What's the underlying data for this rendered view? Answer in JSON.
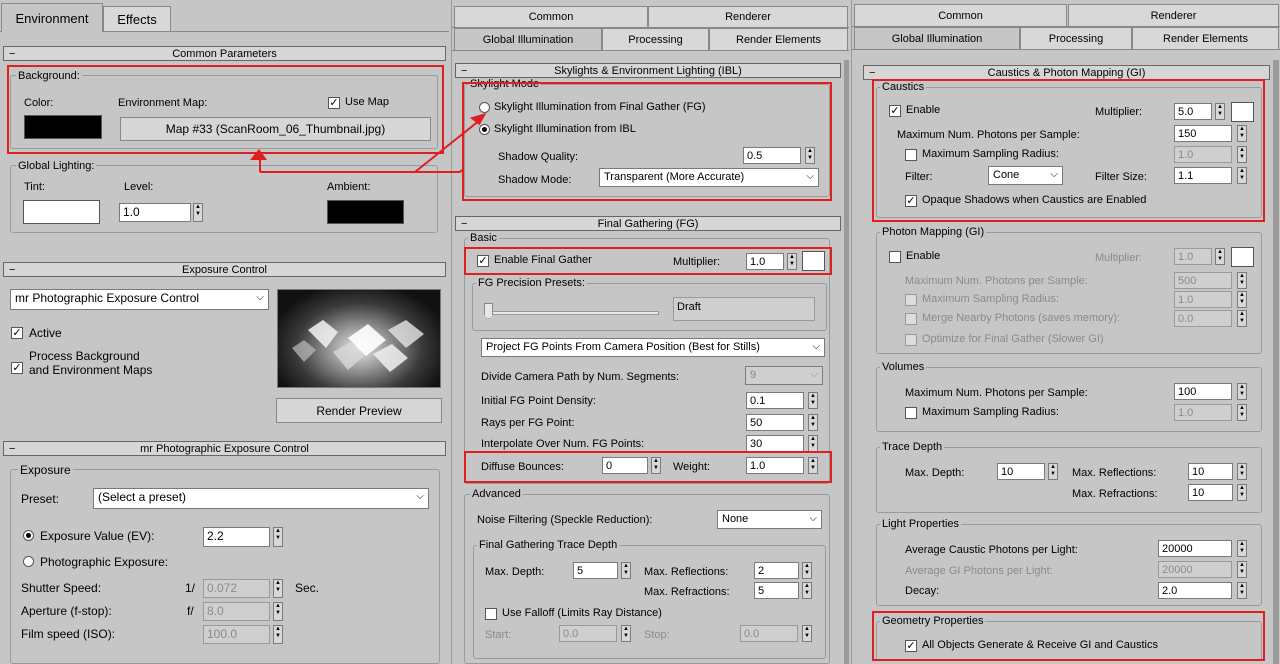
{
  "left": {
    "tabs": [
      "Environment",
      "Effects"
    ],
    "common_params": {
      "title": "Common Parameters",
      "background": {
        "group": "Background:",
        "color_label": "Color:",
        "env_map_label": "Environment Map:",
        "use_map_label": "Use Map",
        "use_map_checked": "✓",
        "map_button": "Map #33 (ScanRoom_06_Thumbnail.jpg)",
        "color_value": "#000000"
      },
      "global_lighting": {
        "group": "Global Lighting:",
        "tint_label": "Tint:",
        "level_label": "Level:",
        "level_value": "1.0",
        "ambient_label": "Ambient:"
      }
    },
    "exposure_control": {
      "title": "Exposure Control",
      "selected": "mr Photographic Exposure Control",
      "active_label": "Active",
      "active_checked": "✓",
      "process_bg_label": "Process Background",
      "process_bg_label2": "and Environment Maps",
      "process_bg_checked": "✓",
      "render_preview": "Render Preview"
    },
    "mr_exposure": {
      "title": "mr Photographic Exposure Control",
      "group": "Exposure",
      "preset_label": "Preset:",
      "preset_value": "(Select a preset)",
      "ev_label": "Exposure Value (EV):",
      "ev_value": "2.2",
      "photo_label": "Photographic Exposure:",
      "shutter_label": "Shutter Speed:",
      "shutter_prefix": "1/",
      "shutter_value": "0.072",
      "shutter_unit": "Sec.",
      "aperture_label": "Aperture (f-stop):",
      "aperture_prefix": "f/",
      "aperture_value": "8.0",
      "film_label": "Film speed (ISO):",
      "film_value": "100.0"
    }
  },
  "middle": {
    "tabs_top": [
      "Common",
      "Renderer"
    ],
    "tabs_bottom": [
      "Global Illumination",
      "Processing",
      "Render Elements"
    ],
    "skylights": {
      "title": "Skylights & Environment Lighting (IBL)",
      "group": "Skylight Mode",
      "opt_fg": "Skylight Illumination from Final Gather (FG)",
      "opt_ibl": "Skylight Illumination from IBL",
      "shadow_quality_label": "Shadow Quality:",
      "shadow_quality_value": "0.5",
      "shadow_mode_label": "Shadow Mode:",
      "shadow_mode_value": "Transparent (More Accurate)"
    },
    "final_gathering": {
      "title": "Final Gathering (FG)",
      "basic_group": "Basic",
      "enable_label": "Enable Final Gather",
      "enable_checked": "✓",
      "multiplier_label": "Multiplier:",
      "multiplier_value": "1.0",
      "presets_group": "FG Precision Presets:",
      "preset_value": "Draft",
      "project_value": "Project FG Points From Camera Position (Best for Stills)",
      "divide_label": "Divide Camera Path by Num. Segments:",
      "divide_value": "9",
      "density_label": "Initial FG Point Density:",
      "density_value": "0.1",
      "rays_label": "Rays per FG Point:",
      "rays_value": "50",
      "interp_label": "Interpolate Over Num. FG Points:",
      "interp_value": "30",
      "bounces_label": "Diffuse Bounces:",
      "bounces_value": "0",
      "weight_label": "Weight:",
      "weight_value": "1.0",
      "advanced_group": "Advanced",
      "noise_label": "Noise Filtering (Speckle Reduction):",
      "noise_value": "None",
      "trace_group": "Final Gathering Trace Depth",
      "max_depth_label": "Max. Depth:",
      "max_depth_value": "5",
      "max_refl_label": "Max. Reflections:",
      "max_refl_value": "2",
      "max_refr_label": "Max. Refractions:",
      "max_refr_value": "5",
      "falloff_label": "Use Falloff (Limits Ray Distance)",
      "start_label": "Start:",
      "start_value": "0.0",
      "stop_label": "Stop:",
      "stop_value": "0.0"
    }
  },
  "right": {
    "tabs_top": [
      "Common",
      "Renderer"
    ],
    "tabs_bottom": [
      "Global Illumination",
      "Processing",
      "Render Elements"
    ],
    "caustics_rollout": {
      "title": "Caustics & Photon Mapping (GI)",
      "caustics": {
        "group": "Caustics",
        "enable_label": "Enable",
        "enable_checked": "✓",
        "multiplier_label": "Multiplier:",
        "multiplier_value": "5.0",
        "max_photons_label": "Maximum Num. Photons per Sample:",
        "max_photons_value": "150",
        "max_radius_label": "Maximum Sampling Radius:",
        "max_radius_value": "1.0",
        "filter_label": "Filter:",
        "filter_value": "Cone",
        "filter_size_label": "Filter Size:",
        "filter_size_value": "1.1",
        "opaque_label": "Opaque Shadows when Caustics are Enabled",
        "opaque_checked": "✓"
      },
      "photon_mapping": {
        "group": "Photon Mapping (GI)",
        "enable_label": "Enable",
        "multiplier_label": "Multiplier:",
        "multiplier_value": "1.0",
        "max_photons_label": "Maximum Num. Photons per Sample:",
        "max_photons_value": "500",
        "max_radius_label": "Maximum Sampling Radius:",
        "max_radius_value": "1.0",
        "merge_label": "Merge Nearby Photons (saves memory):",
        "merge_value": "0.0",
        "optimize_label": "Optimize for Final Gather (Slower GI)"
      },
      "volumes": {
        "group": "Volumes",
        "max_photons_label": "Maximum Num. Photons per Sample:",
        "max_photons_value": "100",
        "max_radius_label": "Maximum Sampling Radius:",
        "max_radius_value": "1.0"
      },
      "trace_depth": {
        "group": "Trace Depth",
        "max_depth_label": "Max. Depth:",
        "max_depth_value": "10",
        "max_refl_label": "Max. Reflections:",
        "max_refl_value": "10",
        "max_refr_label": "Max. Refractions:",
        "max_refr_value": "10"
      },
      "light_props": {
        "group": "Light Properties",
        "avg_caustic_label": "Average Caustic Photons per Light:",
        "avg_caustic_value": "20000",
        "avg_gi_label": "Average GI Photons per Light:",
        "avg_gi_value": "20000",
        "decay_label": "Decay:",
        "decay_value": "2.0"
      },
      "geometry": {
        "group": "Geometry Properties",
        "all_objects_label": "All Objects Generate & Receive GI and Caustics",
        "all_objects_checked": "✓"
      }
    }
  },
  "colors": {
    "highlight": "#e02020",
    "panel": "#c6c6c6"
  }
}
